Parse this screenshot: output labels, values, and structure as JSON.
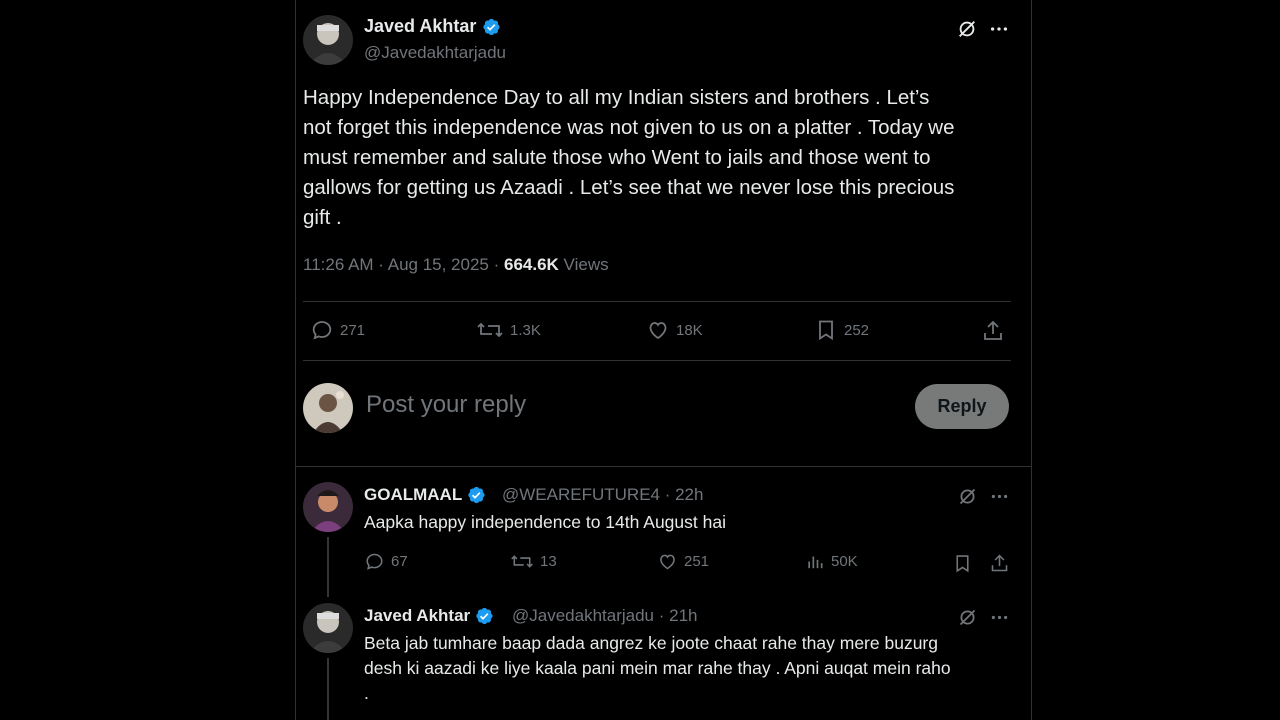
{
  "tweet": {
    "author_name": "Javed Akhtar",
    "author_handle": "@Javedakhtarjadu",
    "text_lines": [
      "Happy Independence Day  to all my Indian sisters and brothers  . Let’s",
      "not forget this independence was not given to us on a platter . Today we",
      "must remember and salute those who Went to jails and those went to",
      "gallows for getting us Azaadi . Let’s see that we never lose this precious",
      "gift ."
    ],
    "time": "11:26 AM · Aug 15, 2025 · ",
    "views_count": "664.6K",
    "views_label": " Views",
    "replies": "271",
    "reposts": "1.3K",
    "likes": "18K",
    "bookmarks": "252"
  },
  "compose": {
    "placeholder": "Post your reply",
    "reply_label": "Reply"
  },
  "reply1": {
    "author_name": "GOALMAAL",
    "meta": "@WEAREFUTURE4 · 22h",
    "text": "Aapka happy independence to 14th August hai",
    "replies": "67",
    "reposts": "13",
    "likes": "251",
    "views": "50K"
  },
  "reply2": {
    "author_name": "Javed Akhtar",
    "meta": "@Javedakhtarjadu · 21h",
    "text_lines": [
      "Beta jab tumhare baap dada angrez ke joote chaat rahe thay mere buzurg",
      "desh ki aazadi ke liye kaala pani mein mar rahe thay . Apni auqat mein raho",
      "."
    ]
  },
  "colors": {
    "background": "#000000",
    "text": "#e7e9ea",
    "muted": "#71767b",
    "verified": "#1d9bf0",
    "divider": "#2f3336",
    "reply_button": "#787a7a"
  },
  "icons": [
    "verified-badge-icon",
    "grok-icon",
    "more-icon",
    "reply-icon",
    "repost-icon",
    "like-icon",
    "bookmark-icon",
    "share-icon",
    "views-icon"
  ]
}
